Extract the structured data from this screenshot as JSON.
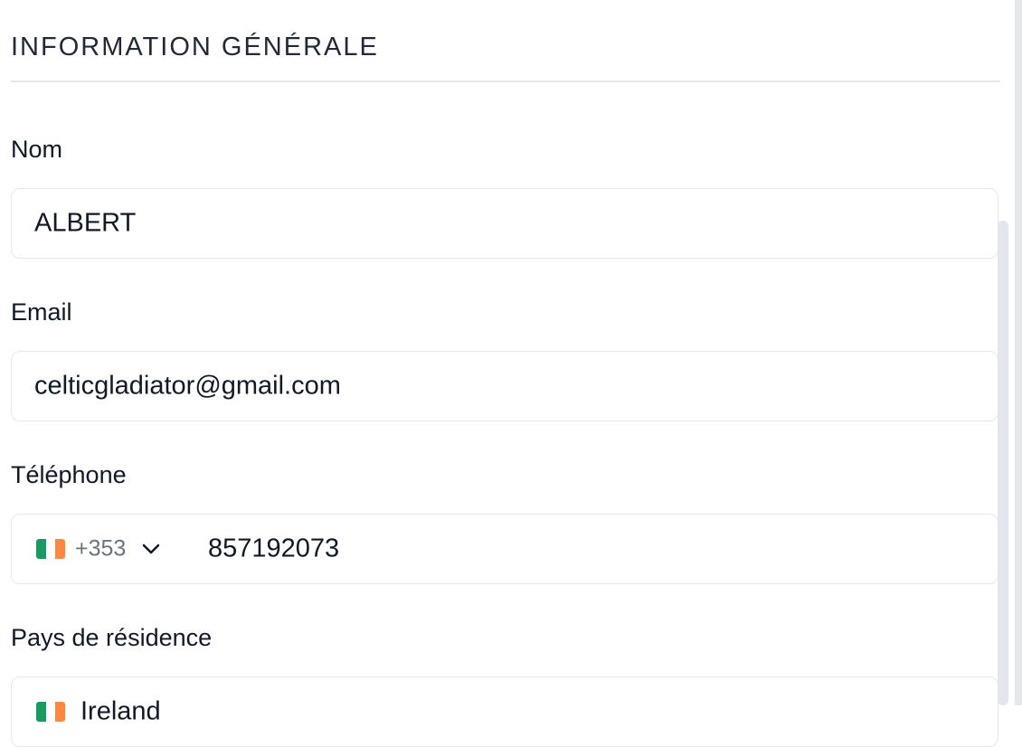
{
  "section": {
    "title": "INFORMATION GÉNÉRALE"
  },
  "fields": {
    "name": {
      "label": "Nom",
      "value": "ALBERT"
    },
    "email": {
      "label": "Email",
      "value": "celticgladiator@gmail.com"
    },
    "phone": {
      "label": "Téléphone",
      "country_flag_icon": "ireland-flag-icon",
      "country_code": "+353",
      "dropdown_icon": "chevron-down-icon",
      "value": "857192073"
    },
    "country": {
      "label": "Pays de résidence",
      "country_flag_icon": "ireland-flag-icon",
      "value": "Ireland"
    }
  },
  "colors": {
    "flag_green": "#169b62",
    "flag_white": "#ffffff",
    "flag_orange": "#ff883e",
    "border": "#e5e7eb",
    "muted_text": "#6b7280"
  }
}
